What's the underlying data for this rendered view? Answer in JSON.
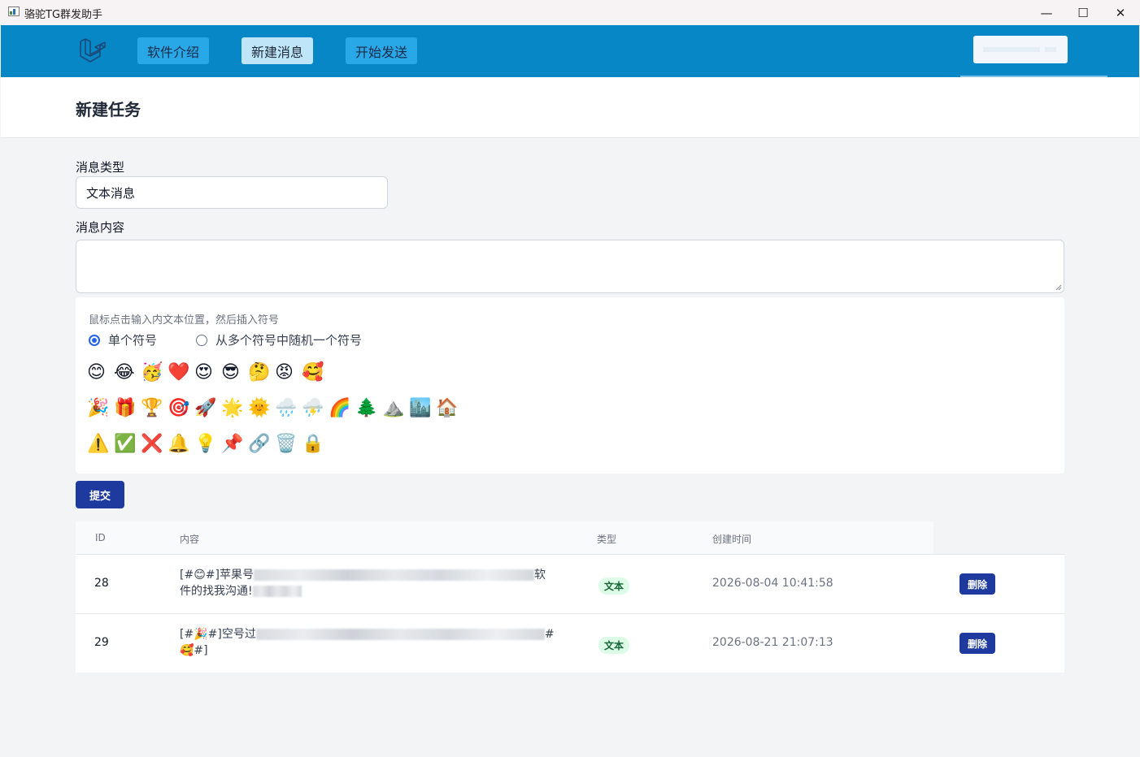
{
  "window": {
    "title": "骆驼TG群发助手",
    "minimize": "—",
    "maximize": "☐",
    "close": "✕"
  },
  "nav": {
    "logo_icon": "laravel-logo-icon",
    "items": [
      {
        "label": "软件介绍",
        "active": false
      },
      {
        "label": "新建消息",
        "active": true
      },
      {
        "label": "开始发送",
        "active": false
      }
    ],
    "brand_color": "#0787c6"
  },
  "page": {
    "title": "新建任务"
  },
  "form": {
    "type_label": "消息类型",
    "type_value": "文本消息",
    "content_label": "消息内容",
    "content_value": "",
    "symbols": {
      "hint": "鼠标点击输入内文本位置，然后插入符号",
      "mode_single": "单个符号",
      "mode_random": "从多个符号中随机一个符号",
      "selected_mode": "single",
      "rows": [
        [
          "😊",
          "😂",
          "🥳",
          "❤️",
          "😍",
          "😎",
          "🤔",
          "😡",
          "🥰"
        ],
        [
          "🎉",
          "🎁",
          "🏆",
          "🎯",
          "🚀",
          "🌟",
          "🌞",
          "🌧️",
          "⛈️",
          "🌈",
          "🌲",
          "⛰️",
          "🏙️",
          "🏠"
        ],
        [
          "⚠️",
          "✅",
          "❌",
          "🔔",
          "💡",
          "📌",
          "🔗",
          "🗑️",
          "🔒"
        ]
      ]
    },
    "submit_label": "提交"
  },
  "table": {
    "headers": {
      "id": "ID",
      "content": "内容",
      "type": "类型",
      "created": "创建时间"
    },
    "rows": [
      {
        "id": "28",
        "content_start": "[#😊#]苹果号",
        "content_mid": "软",
        "content_end": "件的找我沟通!",
        "type": "文本",
        "created": "2026-08-04 10:41:58",
        "action": "删除"
      },
      {
        "id": "29",
        "content_start": "[#🎉#]空号过",
        "content_mid": "#",
        "content_end": "🥰#]",
        "type": "文本",
        "created": "2026-08-21 21:07:13",
        "action": "删除"
      }
    ]
  }
}
